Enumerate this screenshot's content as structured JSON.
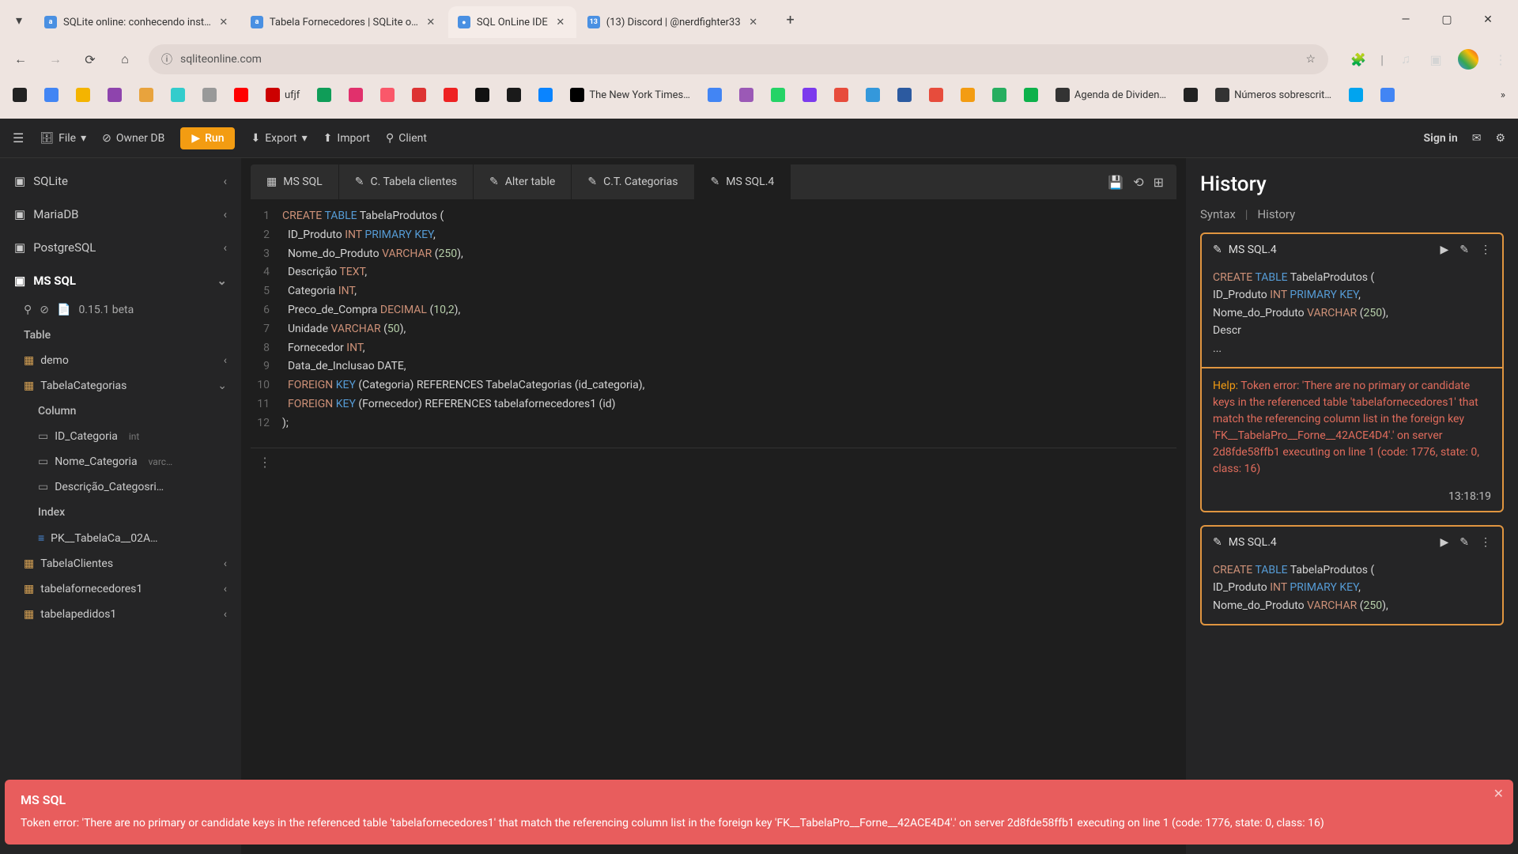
{
  "browser": {
    "tabs": [
      {
        "title": "SQLite online: conhecendo inst…",
        "favicon": "a"
      },
      {
        "title": "Tabela Fornecedores | SQLite o…",
        "favicon": "a"
      },
      {
        "title": "SQL OnLine IDE",
        "favicon": "●",
        "active": true
      },
      {
        "title": "(13) Discord | @nerdfighter33",
        "favicon": "13"
      }
    ],
    "url": "sqliteonline.com",
    "bookmarks": [
      {
        "label": "",
        "color": "#222"
      },
      {
        "label": "",
        "color": "#4285f4"
      },
      {
        "label": "",
        "color": "#f4b400"
      },
      {
        "label": "",
        "color": "#8e44ad"
      },
      {
        "label": "",
        "color": "#e8a33d"
      },
      {
        "label": "",
        "color": "#3cc"
      },
      {
        "label": "",
        "color": "#999"
      },
      {
        "label": "",
        "color": "#ff0000"
      },
      {
        "label": "ufjf",
        "color": "#c00"
      },
      {
        "label": "",
        "color": "#0f9d58"
      },
      {
        "label": "",
        "color": "#e1306c"
      },
      {
        "label": "",
        "color": "#fa586a"
      },
      {
        "label": "",
        "color": "#d33"
      },
      {
        "label": "",
        "color": "#e22"
      },
      {
        "label": "",
        "color": "#111"
      },
      {
        "label": "",
        "color": "#1a1a1a"
      },
      {
        "label": "",
        "color": "#0a84ff"
      },
      {
        "label": "The New York Times…",
        "color": "#000"
      },
      {
        "label": "",
        "color": "#4285f4"
      },
      {
        "label": "",
        "color": "#9b59b6"
      },
      {
        "label": "",
        "color": "#25D366"
      },
      {
        "label": "",
        "color": "#7c3aed"
      },
      {
        "label": "",
        "color": "#e74c3c"
      },
      {
        "label": "",
        "color": "#3498db"
      },
      {
        "label": "",
        "color": "#2c5aa0"
      },
      {
        "label": "",
        "color": "#e74c3c"
      },
      {
        "label": "",
        "color": "#f39c12"
      },
      {
        "label": "",
        "color": "#27ae60"
      },
      {
        "label": "",
        "color": "#0db14b"
      },
      {
        "label": "Agenda de Dividen…",
        "color": "#333"
      },
      {
        "label": "",
        "color": "#222"
      },
      {
        "label": "Números sobrescrit…",
        "color": "#333"
      },
      {
        "label": "",
        "color": "#00a4ef"
      },
      {
        "label": "",
        "color": "#4285f4"
      }
    ]
  },
  "toolbar": {
    "file": "File",
    "owner_db": "Owner DB",
    "run": "Run",
    "export": "Export",
    "import": "Import",
    "client": "Client",
    "sign_in": "Sign in"
  },
  "sidebar": {
    "engines": [
      {
        "name": "SQLite"
      },
      {
        "name": "MariaDB"
      },
      {
        "name": "PostgreSQL"
      },
      {
        "name": "MS SQL",
        "active": true
      }
    ],
    "version": "0.15.1 beta",
    "table_header": "Table",
    "tables": [
      {
        "name": "demo",
        "expandable": true
      },
      {
        "name": "TabelaCategorias",
        "expanded": true
      },
      {
        "name": "TabelaClientes",
        "expandable": true
      },
      {
        "name": "tabelafornecedores1",
        "expandable": true
      },
      {
        "name": "tabelapedidos1",
        "expandable": true
      }
    ],
    "column_header": "Column",
    "columns": [
      {
        "name": "ID_Categoria",
        "type": "int"
      },
      {
        "name": "Nome_Categoria",
        "type": "varc…"
      },
      {
        "name": "Descrição_Categosri…",
        "type": ""
      }
    ],
    "index_header": "Index",
    "indexes": [
      {
        "name": "PK__TabelaCa__02A…"
      }
    ]
  },
  "editor": {
    "tabs": [
      {
        "label": "MS SQL",
        "icon": "db"
      },
      {
        "label": "C. Tabela clientes",
        "icon": "edit"
      },
      {
        "label": "Alter table",
        "icon": "edit"
      },
      {
        "label": "C.T. Categorias",
        "icon": "edit"
      },
      {
        "label": "MS SQL.4",
        "icon": "edit",
        "active": true
      }
    ],
    "lines": [
      {
        "n": 1,
        "tokens": [
          [
            "CREATE",
            "kw-orange"
          ],
          [
            " ",
            ""
          ],
          [
            "TABLE",
            "kw-blue"
          ],
          [
            " TabelaProdutos (",
            ""
          ]
        ]
      },
      {
        "n": 2,
        "tokens": [
          [
            "  ID_Produto ",
            ""
          ],
          [
            "INT",
            "kw-type"
          ],
          [
            " ",
            ""
          ],
          [
            "PRIMARY",
            "kw-blue"
          ],
          [
            " ",
            ""
          ],
          [
            "KEY",
            "kw-blue"
          ],
          [
            ",",
            ""
          ]
        ]
      },
      {
        "n": 3,
        "tokens": [
          [
            "  Nome_do_Produto ",
            ""
          ],
          [
            "VARCHAR",
            "kw-type"
          ],
          [
            " (",
            ""
          ],
          [
            "250",
            "kw-num"
          ],
          [
            "),",
            ""
          ]
        ]
      },
      {
        "n": 4,
        "tokens": [
          [
            "  Descrição ",
            ""
          ],
          [
            "TEXT",
            "kw-type"
          ],
          [
            ",",
            ""
          ]
        ]
      },
      {
        "n": 5,
        "tokens": [
          [
            "  Categoria ",
            ""
          ],
          [
            "INT",
            "kw-type"
          ],
          [
            ",",
            ""
          ]
        ]
      },
      {
        "n": 6,
        "tokens": [
          [
            "  Preco_de_Compra ",
            ""
          ],
          [
            "DECIMAL",
            "kw-type"
          ],
          [
            " (",
            ""
          ],
          [
            "10",
            "kw-num"
          ],
          [
            ",",
            ""
          ],
          [
            "2",
            "kw-num"
          ],
          [
            "),",
            ""
          ]
        ]
      },
      {
        "n": 7,
        "tokens": [
          [
            "  Unidade ",
            ""
          ],
          [
            "VARCHAR",
            "kw-type"
          ],
          [
            " (",
            ""
          ],
          [
            "50",
            "kw-num"
          ],
          [
            "),",
            ""
          ]
        ]
      },
      {
        "n": 8,
        "tokens": [
          [
            "  Fornecedor ",
            ""
          ],
          [
            "INT",
            "kw-type"
          ],
          [
            ",",
            ""
          ]
        ]
      },
      {
        "n": 9,
        "tokens": [
          [
            "  Data_de_Inclusao DATE,",
            ""
          ]
        ]
      },
      {
        "n": 10,
        "tokens": [
          [
            "  ",
            ""
          ],
          [
            "FOREIGN",
            "kw-orange"
          ],
          [
            " ",
            ""
          ],
          [
            "KEY",
            "kw-blue"
          ],
          [
            " (Categoria) REFERENCES TabelaCategorias (id_categoria),",
            ""
          ]
        ]
      },
      {
        "n": 11,
        "tokens": [
          [
            "  ",
            ""
          ],
          [
            "FOREIGN",
            "kw-orange"
          ],
          [
            " ",
            ""
          ],
          [
            "KEY",
            "kw-blue"
          ],
          [
            " (Fornecedor) REFERENCES tabelafornecedores1 (id)",
            ""
          ]
        ]
      },
      {
        "n": 12,
        "tokens": [
          [
            ");",
            ""
          ]
        ]
      }
    ]
  },
  "history": {
    "title": "History",
    "tab_syntax": "Syntax",
    "tab_history": "History",
    "items": [
      {
        "title": "MS SQL.4",
        "code_tokens": [
          [
            [
              "CREATE",
              "kw-orange"
            ],
            [
              " ",
              ""
            ],
            [
              "TABLE",
              "kw-blue"
            ],
            [
              " TabelaProdutos (",
              ""
            ]
          ],
          [
            [
              "  ID_Produto ",
              ""
            ],
            [
              "INT",
              "kw-type"
            ],
            [
              " ",
              ""
            ],
            [
              "PRIMARY",
              "kw-blue"
            ],
            [
              " ",
              ""
            ],
            [
              "KEY",
              "kw-blue"
            ],
            [
              ",",
              ""
            ]
          ],
          [
            [
              "  Nome_do_Produto ",
              ""
            ],
            [
              "VARCHAR",
              "kw-type"
            ],
            [
              " (",
              ""
            ],
            [
              "250",
              "kw-num"
            ],
            [
              "),",
              ""
            ]
          ],
          [
            [
              "  Descr",
              ""
            ]
          ],
          [
            [
              "...",
              ""
            ]
          ]
        ],
        "help_label": "Help:",
        "error": " Token error: 'There are no primary or candidate keys in the referenced table 'tabelafornecedores1' that match the referencing column list in the foreign key 'FK__TabelaPro__Forne__42ACE4D4'.' on server 2d8fde58ffb1 executing on line 1 (code: 1776, state: 0, class: 16)",
        "time": "13:18:19"
      },
      {
        "title": "MS SQL.4",
        "code_tokens": [
          [
            [
              "CREATE",
              "kw-orange"
            ],
            [
              " ",
              ""
            ],
            [
              "TABLE",
              "kw-blue"
            ],
            [
              " TabelaProdutos (",
              ""
            ]
          ],
          [
            [
              "  ID_Produto ",
              ""
            ],
            [
              "INT",
              "kw-type"
            ],
            [
              " ",
              ""
            ],
            [
              "PRIMARY",
              "kw-blue"
            ],
            [
              " ",
              ""
            ],
            [
              "KEY",
              "kw-blue"
            ],
            [
              ",",
              ""
            ]
          ],
          [
            [
              "  Nome_do_Produto ",
              ""
            ],
            [
              "VARCHAR",
              "kw-type"
            ],
            [
              " (",
              ""
            ],
            [
              "250",
              "kw-num"
            ],
            [
              "),",
              ""
            ]
          ]
        ]
      }
    ]
  },
  "toast": {
    "title": "MS SQL",
    "message": "Token error: 'There are no primary or candidate keys in the referenced table 'tabelafornecedores1' that match the referencing column list in the foreign key 'FK__TabelaPro__Forne__42ACE4D4'.' on server 2d8fde58ffb1 executing on line 1 (code: 1776, state: 0, class: 16)"
  }
}
